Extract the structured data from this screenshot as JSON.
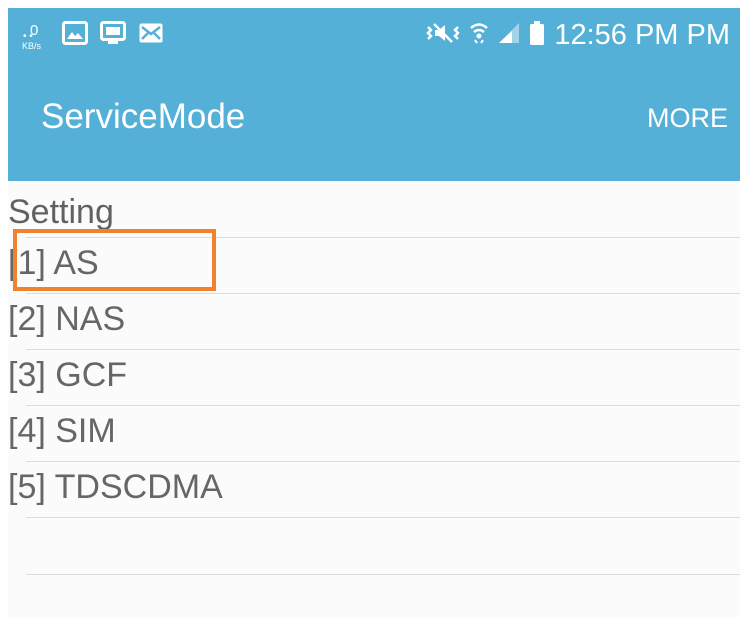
{
  "status_bar": {
    "speed_value": "0",
    "speed_unit": "KB/s",
    "time": "12:56 PM PM",
    "left_icons": [
      "network-speed-icon",
      "gallery-notification-icon",
      "screen-mirror-notification-icon",
      "message-notification-icon"
    ],
    "right_icons": [
      "mute-vibrate-icon",
      "wifi-icon",
      "cellular-signal-icon",
      "battery-icon"
    ]
  },
  "app_bar": {
    "title": "ServiceMode",
    "more_label": "MORE"
  },
  "content": {
    "section_title": "Setting",
    "items": [
      {
        "label": "[1] AS"
      },
      {
        "label": "[2] NAS"
      },
      {
        "label": "[3] GCF"
      },
      {
        "label": "[4] SIM"
      },
      {
        "label": "[5] TDSCDMA"
      }
    ]
  },
  "colors": {
    "header_bg": "#55b0d8",
    "highlight": "#f2812f",
    "text": "#666666",
    "divider": "#dcdcdc"
  }
}
